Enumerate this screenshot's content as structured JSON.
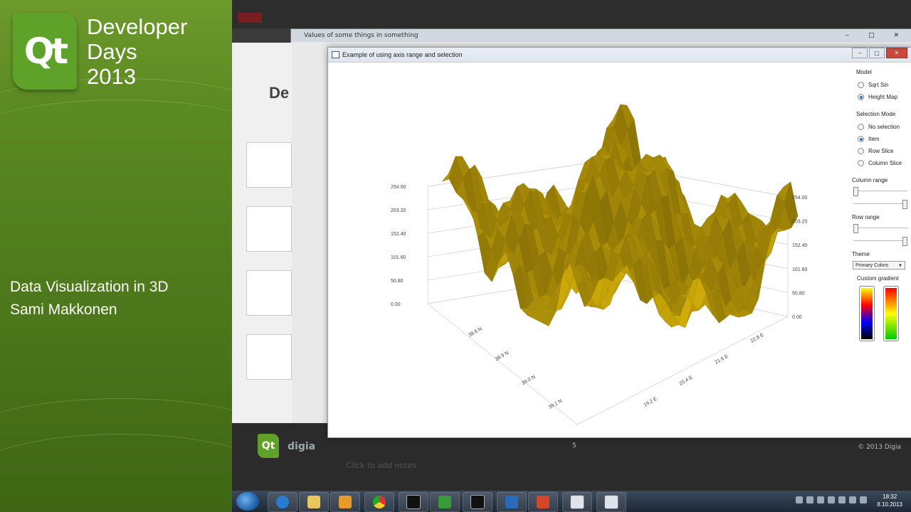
{
  "conference": {
    "logo_text": "Qt",
    "title_lines": [
      "Developer",
      "Days",
      "2013"
    ],
    "talk_title": "Data Visualization in 3D",
    "speaker": "Sami Makkonen"
  },
  "background": {
    "back_window_title": "Values of some things in something",
    "slide_title_fragment": "De",
    "footer_copyright": "© 2013 Digia",
    "page_number": "5",
    "notes": "Click to add notes",
    "brand_text": "digia"
  },
  "app": {
    "window_title": "Example of using axis range and selection",
    "controls": {
      "model_label": "Model",
      "model_options": [
        "Sqrt Sin",
        "Height Map"
      ],
      "model_selected": 1,
      "selection_label": "Selection Mode",
      "selection_options": [
        "No selection",
        "Item",
        "Row Slice",
        "Column Slice"
      ],
      "selection_selected": 1,
      "column_range_label": "Column range",
      "row_range_label": "Row range",
      "theme_label": "Theme",
      "theme_value": "Primary Colors",
      "gradient_label": "Custom gradient"
    },
    "graph": {
      "surface_color": "#d4b000",
      "y_ticks": [
        "254.00",
        "203.20",
        "152.40",
        "101.60",
        "50.80",
        "0.00"
      ],
      "x_ticks": [
        "38.8 N",
        "38.9 N",
        "39.0 N",
        "39.1 N"
      ],
      "z_ticks": [
        "19.2 E",
        "20.4 E",
        "21.6 E",
        "22.8 E"
      ]
    },
    "gradients": [
      {
        "colors": [
          "#ffff00",
          "#ff0000",
          "#0000ff",
          "#000000"
        ]
      },
      {
        "colors": [
          "#ff0000",
          "#ffff00",
          "#00cc00"
        ]
      }
    ]
  },
  "taskbar": {
    "time": "18:32",
    "date": "8.10.2013",
    "apps": [
      "ie-icon",
      "folder-icon",
      "outlook-icon",
      "chrome-icon",
      "terminal-icon",
      "chart-app-icon",
      "terminal-2-icon",
      "lync-icon",
      "powerpoint-icon",
      "window-icon",
      "window-2-icon"
    ]
  }
}
